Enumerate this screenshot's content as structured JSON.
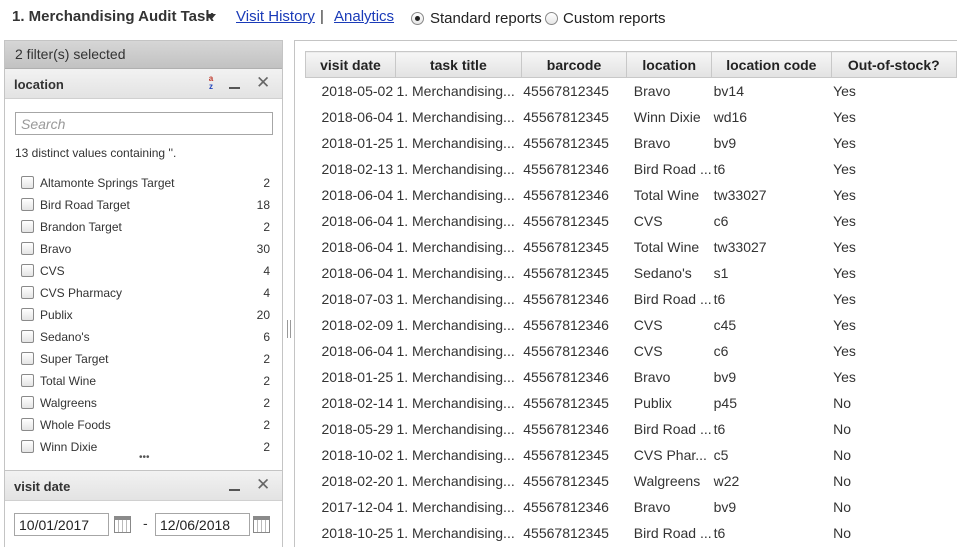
{
  "topbar": {
    "task_title": "1. Merchandising Audit Task",
    "visit_history": "Visit History",
    "separator": "|",
    "analytics": "Analytics",
    "standard_reports": "Standard reports",
    "custom_reports": "Custom reports",
    "selected_report_mode": "Standard reports"
  },
  "filter_panel": {
    "header": "2 filter(s) selected",
    "location": {
      "title": "location",
      "search_placeholder": "Search",
      "distinct_note": "13 distinct values containing ''.",
      "values": [
        {
          "label": "Altamonte Springs Target",
          "count": "2"
        },
        {
          "label": "Bird Road Target",
          "count": "18"
        },
        {
          "label": "Brandon Target",
          "count": "2"
        },
        {
          "label": "Bravo",
          "count": "30"
        },
        {
          "label": "CVS",
          "count": "4"
        },
        {
          "label": "CVS Pharmacy",
          "count": "4"
        },
        {
          "label": "Publix",
          "count": "20"
        },
        {
          "label": "Sedano's",
          "count": "6"
        },
        {
          "label": "Super Target",
          "count": "2"
        },
        {
          "label": "Total Wine",
          "count": "2"
        },
        {
          "label": "Walgreens",
          "count": "2"
        },
        {
          "label": "Whole Foods",
          "count": "2"
        },
        {
          "label": "Winn Dixie",
          "count": "2"
        }
      ],
      "more": "•••"
    },
    "visit_date": {
      "title": "visit date",
      "from": "10/01/2017",
      "dash": "-",
      "to": "12/06/2018"
    }
  },
  "table": {
    "columns": [
      "visit date",
      "task title",
      "barcode",
      "location",
      "location code",
      "Out-of-stock?"
    ],
    "rows": [
      [
        "2018-05-02",
        "1. Merchandising...",
        "45567812345",
        "Bravo",
        "bv14",
        "Yes"
      ],
      [
        "2018-06-04",
        "1. Merchandising...",
        "45567812345",
        "Winn Dixie",
        "wd16",
        "Yes"
      ],
      [
        "2018-01-25",
        "1. Merchandising...",
        "45567812345",
        "Bravo",
        "bv9",
        "Yes"
      ],
      [
        "2018-02-13",
        "1. Merchandising...",
        "45567812346",
        "Bird Road ...",
        "t6",
        "Yes"
      ],
      [
        "2018-06-04",
        "1. Merchandising...",
        "45567812346",
        "Total Wine",
        "tw33027",
        "Yes"
      ],
      [
        "2018-06-04",
        "1. Merchandising...",
        "45567812345",
        "CVS",
        "c6",
        "Yes"
      ],
      [
        "2018-06-04",
        "1. Merchandising...",
        "45567812345",
        "Total Wine",
        "tw33027",
        "Yes"
      ],
      [
        "2018-06-04",
        "1. Merchandising...",
        "45567812345",
        "Sedano's",
        "s1",
        "Yes"
      ],
      [
        "2018-07-03",
        "1. Merchandising...",
        "45567812346",
        "Bird Road ...",
        "t6",
        "Yes"
      ],
      [
        "2018-02-09",
        "1. Merchandising...",
        "45567812346",
        "CVS",
        "c45",
        "Yes"
      ],
      [
        "2018-06-04",
        "1. Merchandising...",
        "45567812346",
        "CVS",
        "c6",
        "Yes"
      ],
      [
        "2018-01-25",
        "1. Merchandising...",
        "45567812346",
        "Bravo",
        "bv9",
        "Yes"
      ],
      [
        "2018-02-14",
        "1. Merchandising...",
        "45567812345",
        "Publix",
        "p45",
        "No"
      ],
      [
        "2018-05-29",
        "1. Merchandising...",
        "45567812346",
        "Bird Road ...",
        "t6",
        "No"
      ],
      [
        "2018-10-02",
        "1. Merchandising...",
        "45567812345",
        "CVS Phar...",
        "c5",
        "No"
      ],
      [
        "2018-02-20",
        "1. Merchandising...",
        "45567812345",
        "Walgreens",
        "w22",
        "No"
      ],
      [
        "2017-12-04",
        "1. Merchandising...",
        "45567812346",
        "Bravo",
        "bv9",
        "No"
      ],
      [
        "2018-10-25",
        "1. Merchandising...",
        "45567812345",
        "Bird Road ...",
        "t6",
        "No"
      ]
    ]
  },
  "icons": {
    "task_dropdown": "chevron-down-icon",
    "sort": "sort-az-icon",
    "minimize": "minimize-icon",
    "close": "close-icon",
    "calendar": "calendar-icon",
    "splitter": "splitter-grip-icon"
  }
}
